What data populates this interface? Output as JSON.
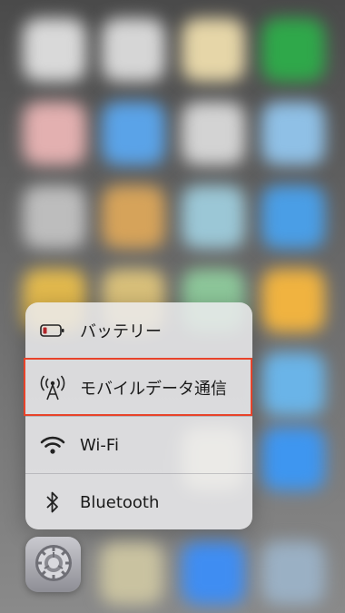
{
  "quick_actions": {
    "items": [
      {
        "label": "バッテリー",
        "icon": "battery-icon"
      },
      {
        "label": "モバイルデータ通信",
        "icon": "cellular-antenna-icon",
        "highlighted": true
      },
      {
        "label": "Wi-Fi",
        "icon": "wifi-icon"
      },
      {
        "label": "Bluetooth",
        "icon": "bluetooth-icon"
      }
    ]
  },
  "app_icon": {
    "icon": "settings-gear-icon"
  },
  "colors": {
    "highlight": "#e8432a",
    "battery_fill": "#b3262a"
  }
}
